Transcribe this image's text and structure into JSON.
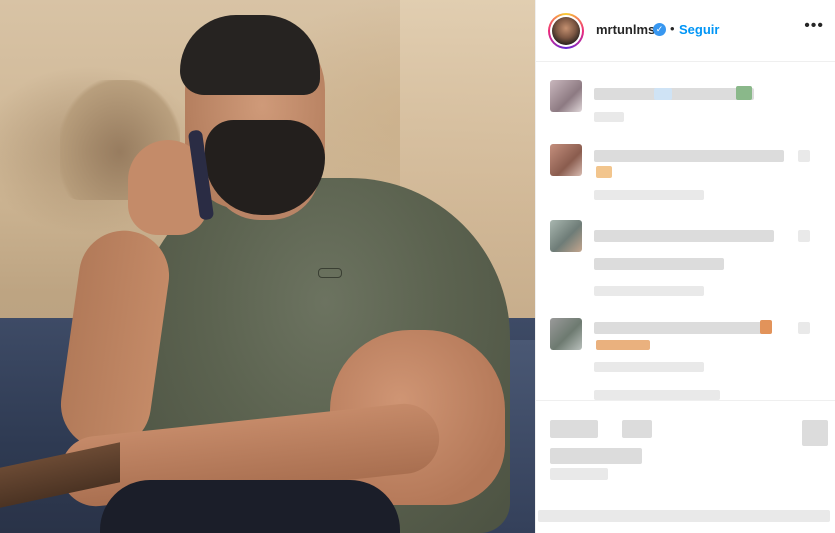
{
  "post": {
    "username": "mrtunlms",
    "verified_icon": "verified-badge-icon",
    "separator": "•",
    "follow_label": "Seguir",
    "more_icon": "more-options-icon",
    "more_glyph": "•••"
  },
  "colors": {
    "follow": "#0095f6",
    "verified": "#3897f0",
    "text": "#262626",
    "border": "#efefef"
  }
}
